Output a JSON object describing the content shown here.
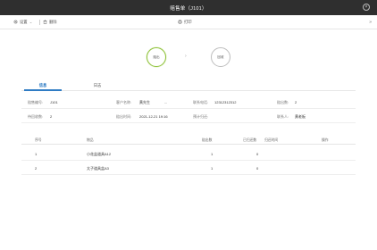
{
  "window": {
    "title": "赔售单（J101）",
    "close_glyph": "×"
  },
  "toolbar": {
    "settings_label": "设置",
    "settings_chevron": "⌄",
    "delete_label": "删除",
    "print_label": "打印",
    "expand_glyph": "»"
  },
  "flow": {
    "step1_label": "赔出",
    "step2_label": "回收",
    "arrow": "›"
  },
  "tabs": [
    {
      "label": "信息"
    },
    {
      "label": "日志"
    }
  ],
  "info": {
    "row1": [
      {
        "label": "赔售编号:",
        "value": "J101"
      },
      {
        "label": "客户名称:",
        "value": "黄先生",
        "extra": "..."
      },
      {
        "label": "联系电话:",
        "value": "12312312312"
      },
      {
        "label": "赔出数:",
        "value": "2"
      }
    ],
    "row2": [
      {
        "label": "待回收数:",
        "value": "2"
      },
      {
        "label": "赔出时间:",
        "value": "2021-12-21 19:16"
      },
      {
        "label": "预计归还:",
        "value": ""
      },
      {
        "label": "联系人:",
        "value": "黄老板"
      }
    ]
  },
  "table": {
    "headers": {
      "index": "序号",
      "product": "物品",
      "qty": "赔出数",
      "returned": "已归还数",
      "return_time": "归还时间",
      "action": "操作"
    },
    "rows": [
      {
        "index": "1",
        "product": "小花盆道具A12",
        "qty": "1",
        "returned": "0",
        "return_time": "",
        "action": ""
      },
      {
        "index": "2",
        "product": "太子道具盆A3",
        "qty": "1",
        "returned": "0",
        "return_time": "",
        "action": ""
      }
    ]
  },
  "colors": {
    "titlebar_bg": "#2f2f2f",
    "accent": "#2f7cc4",
    "step_active": "#8fc23a"
  }
}
